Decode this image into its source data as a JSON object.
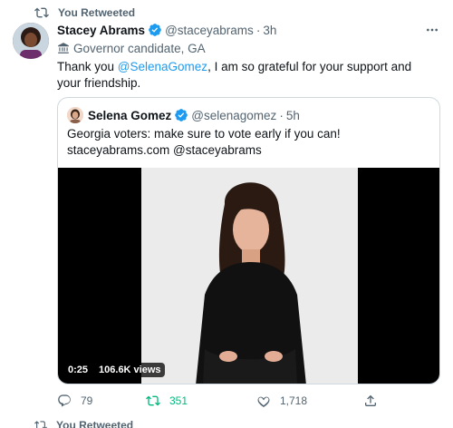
{
  "retweet_banner": {
    "label": "You Retweeted"
  },
  "tweet": {
    "author_name": "Stacey Abrams",
    "handle": "@staceyabrams",
    "separator": "·",
    "time": "3h",
    "bio_label": "Governor candidate, GA",
    "text_before": "Thank you ",
    "mention": "@SelenaGomez",
    "text_after": ", I am so grateful for your support and your friendship."
  },
  "quote": {
    "author_name": "Selena Gomez",
    "handle": "@selenagomez",
    "separator": "·",
    "time": "5h",
    "text": "Georgia voters: make sure to vote early if you can! staceyabrams.com @staceyabrams",
    "video_time": "0:25",
    "video_views": "106.6K views"
  },
  "actions": {
    "reply_count": "79",
    "retweet_count": "351",
    "like_count": "1,718"
  },
  "next_banner": {
    "label": "You Retweeted"
  },
  "colors": {
    "accent": "#1d9bf0",
    "retweet_green": "#00ba7c",
    "muted": "#536471"
  }
}
